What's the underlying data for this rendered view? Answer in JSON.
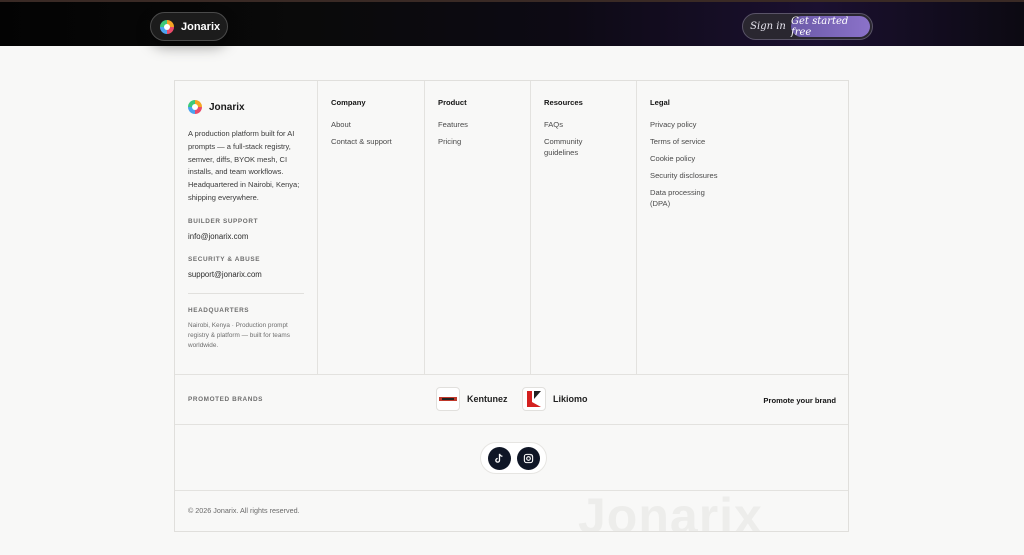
{
  "header": {
    "brand": "Jonarix",
    "signin_label": "Sign in",
    "cta_label": "Get started free"
  },
  "footer": {
    "brand": "Jonarix",
    "description": "A production platform built for AI prompts — a full-stack registry, semver, diffs, BYOK mesh, CI installs, and team workflows. Headquartered in Nairobi, Kenya; shipping everywhere.",
    "builder_support_label": "BUILDER SUPPORT",
    "builder_support_email": "info@jonarix.com",
    "security_label": "SECURITY & ABUSE",
    "security_email": "support@jonarix.com",
    "hq_label": "HEADQUARTERS",
    "hq_text": "Nairobi, Kenya · Production prompt registry & platform — built for teams worldwide.",
    "columns": [
      {
        "title": "Company",
        "links": [
          "About",
          "Contact & support"
        ]
      },
      {
        "title": "Product",
        "links": [
          "Features",
          "Pricing"
        ]
      },
      {
        "title": "Resources",
        "links": [
          "FAQs",
          "Community guidelines"
        ]
      },
      {
        "title": "Legal",
        "links": [
          "Privacy policy",
          "Terms of service",
          "Cookie policy",
          "Security disclosures",
          "Data processing (DPA)"
        ]
      }
    ],
    "promoted_label": "PROMOTED BRANDS",
    "promoted_brands": [
      {
        "name": "Kentunez",
        "icon": "kentunez-logo"
      },
      {
        "name": "Likiomo",
        "icon": "likiomo-logo"
      }
    ],
    "promote_cta": "Promote your brand",
    "social": [
      "tiktok-icon",
      "instagram-icon"
    ],
    "copyright": "© 2026 Jonarix. All rights reserved.",
    "watermark": "Jonarix"
  },
  "colors": {
    "accent": "#7a64bb",
    "social_bg": "#0f1626"
  }
}
